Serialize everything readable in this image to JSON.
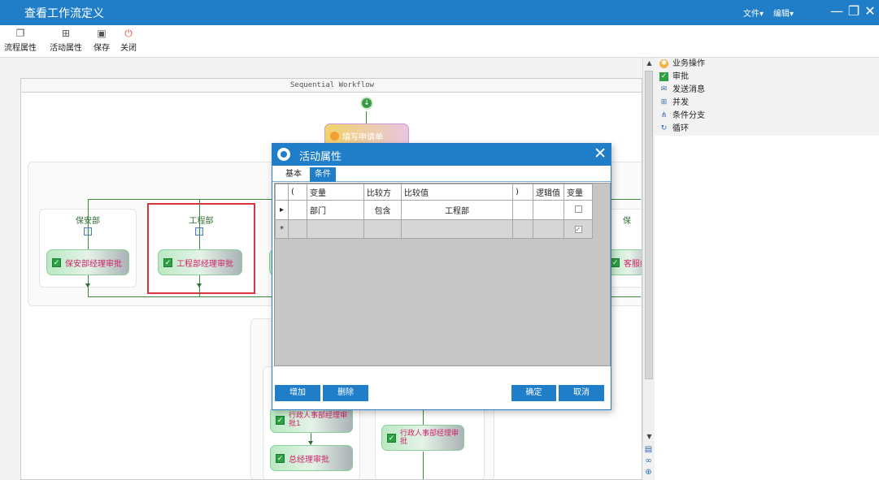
{
  "window": {
    "title": "查看工作流定义",
    "menu_file": "文件",
    "menu_edit": "编辑",
    "minimize": "—",
    "restore": "❐",
    "close": "✕"
  },
  "toolbar": {
    "process_props": "流程属性",
    "activity_props": "活动属性",
    "save": "保存",
    "close": "关闭"
  },
  "workflow": {
    "header": "Sequential Workflow",
    "start_activity": "填写申请单",
    "branches": [
      {
        "label": "保安部",
        "activity": "保安部经理审批"
      },
      {
        "label": "工程部",
        "activity": "工程部经理审批"
      },
      {
        "label": "保",
        "activity": "客服经"
      }
    ],
    "lower_activities": {
      "left_1": "行政人事部经理审批1",
      "left_2": "总经理审批",
      "right_1": "行政人事部经理审批"
    }
  },
  "toolbox": {
    "items": [
      {
        "label": "业务操作",
        "icon": "gear-icon"
      },
      {
        "label": "审批",
        "icon": "check-icon"
      },
      {
        "label": "发送消息",
        "icon": "message-icon"
      },
      {
        "label": "并发",
        "icon": "parallel-icon"
      },
      {
        "label": "条件分支",
        "icon": "branch-icon"
      },
      {
        "label": "循环",
        "icon": "loop-icon"
      }
    ]
  },
  "dialog": {
    "title": "活动属性",
    "tabs": [
      "基本",
      "条件"
    ],
    "active_tab": "条件",
    "columns": [
      "(",
      "变量",
      "比较方",
      "比较值",
      ")",
      "逻辑值",
      "变量"
    ],
    "rows": [
      {
        "marker": "▸",
        "lparen": "",
        "variable": "部门",
        "operator": "包含",
        "value": "工程部",
        "rparen": "",
        "logic": "",
        "is_variable": false
      }
    ],
    "new_row_marker": "*",
    "new_row_is_variable": true,
    "buttons": {
      "add": "增加",
      "delete": "删除",
      "ok": "确定",
      "cancel": "取消"
    }
  },
  "colors": {
    "accent": "#1f7ec7",
    "activity_text": "#d0226a",
    "selection": "#d9333d"
  }
}
